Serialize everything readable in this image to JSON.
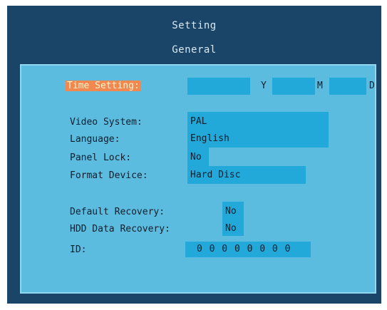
{
  "window": {
    "title": "Setting",
    "section": "General"
  },
  "time_setting": {
    "label": "Time Setting:",
    "year_unit": "Y",
    "month_unit": "M",
    "day_unit": "D"
  },
  "fields": {
    "video_system": {
      "label": "Video System:",
      "value": "PAL"
    },
    "language": {
      "label": "Language:",
      "value": "English"
    },
    "panel_lock": {
      "label": "Panel Lock:",
      "value": "No"
    },
    "format_device": {
      "label": "Format Device:",
      "value": "Hard Disc"
    },
    "default_recovery": {
      "label": "Default Recovery:",
      "value": "No"
    },
    "hdd_data_recovery": {
      "label": "HDD Data Recovery:",
      "value": "No"
    },
    "id": {
      "label": "ID:",
      "value": "0 0 0 0 0 0 0 0"
    }
  },
  "colors": {
    "frame": "#1a4569",
    "panel": "#5bbcdf",
    "field": "#23a9d9",
    "highlight": "#f08850"
  }
}
